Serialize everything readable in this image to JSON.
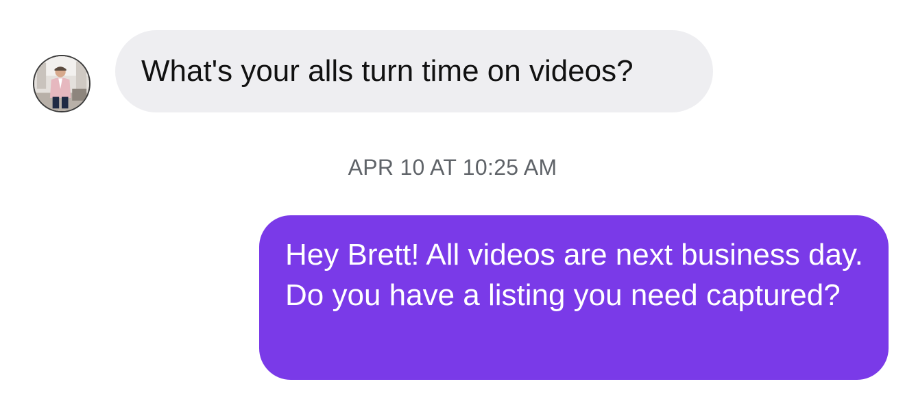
{
  "conversation": {
    "incoming": {
      "sender_avatar": "avatar-photo",
      "text": "What's your alls turn time on videos?"
    },
    "timestamp": "APR 10 AT 10:25 AM",
    "outgoing": {
      "text": "Hey Brett! All videos are next business day. Do you have a listing you need captured?"
    }
  },
  "colors": {
    "incoming_bubble": "#eeeef1",
    "outgoing_bubble": "#7a3ae8",
    "timestamp_text": "#5f6368"
  }
}
